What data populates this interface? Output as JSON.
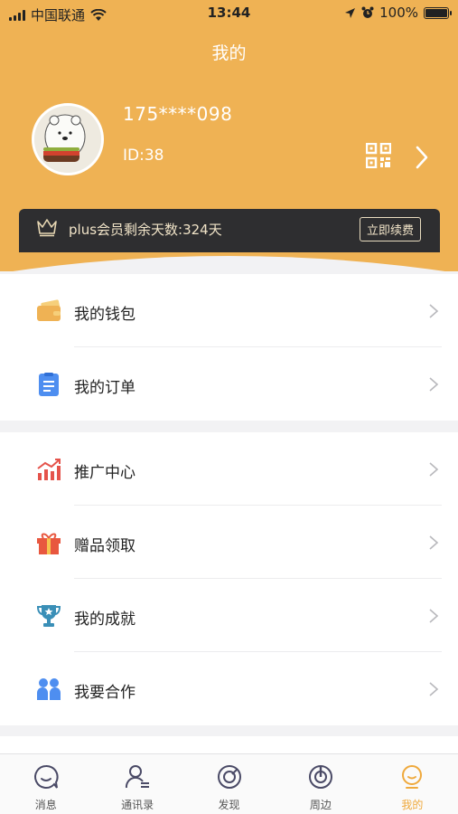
{
  "status_bar": {
    "carrier": "中国联通",
    "time": "13:44",
    "battery": "100%"
  },
  "header": {
    "title": "我的",
    "phone": "175****098",
    "user_id": "ID:38"
  },
  "vip": {
    "text": "plus会员剩余天数:324天",
    "renew_label": "立即续费"
  },
  "menu_groups": [
    {
      "items": [
        {
          "label": "我的钱包",
          "icon": "wallet-icon"
        },
        {
          "label": "我的订单",
          "icon": "order-icon"
        }
      ]
    },
    {
      "items": [
        {
          "label": "推广中心",
          "icon": "chart-icon"
        },
        {
          "label": "赠品领取",
          "icon": "gift-icon"
        },
        {
          "label": "我的成就",
          "icon": "trophy-icon"
        },
        {
          "label": "我要合作",
          "icon": "cooperation-icon"
        }
      ]
    }
  ],
  "tabbar": [
    {
      "label": "消息",
      "icon": "message-icon",
      "active": false
    },
    {
      "label": "通讯录",
      "icon": "contacts-icon",
      "active": false
    },
    {
      "label": "发现",
      "icon": "discover-icon",
      "active": false
    },
    {
      "label": "周边",
      "icon": "nearby-icon",
      "active": false
    },
    {
      "label": "我的",
      "icon": "profile-icon",
      "active": true
    }
  ],
  "colors": {
    "header_bg": "#efb254",
    "vip_bg": "#2e2e30",
    "active_tab": "#efa93c"
  }
}
